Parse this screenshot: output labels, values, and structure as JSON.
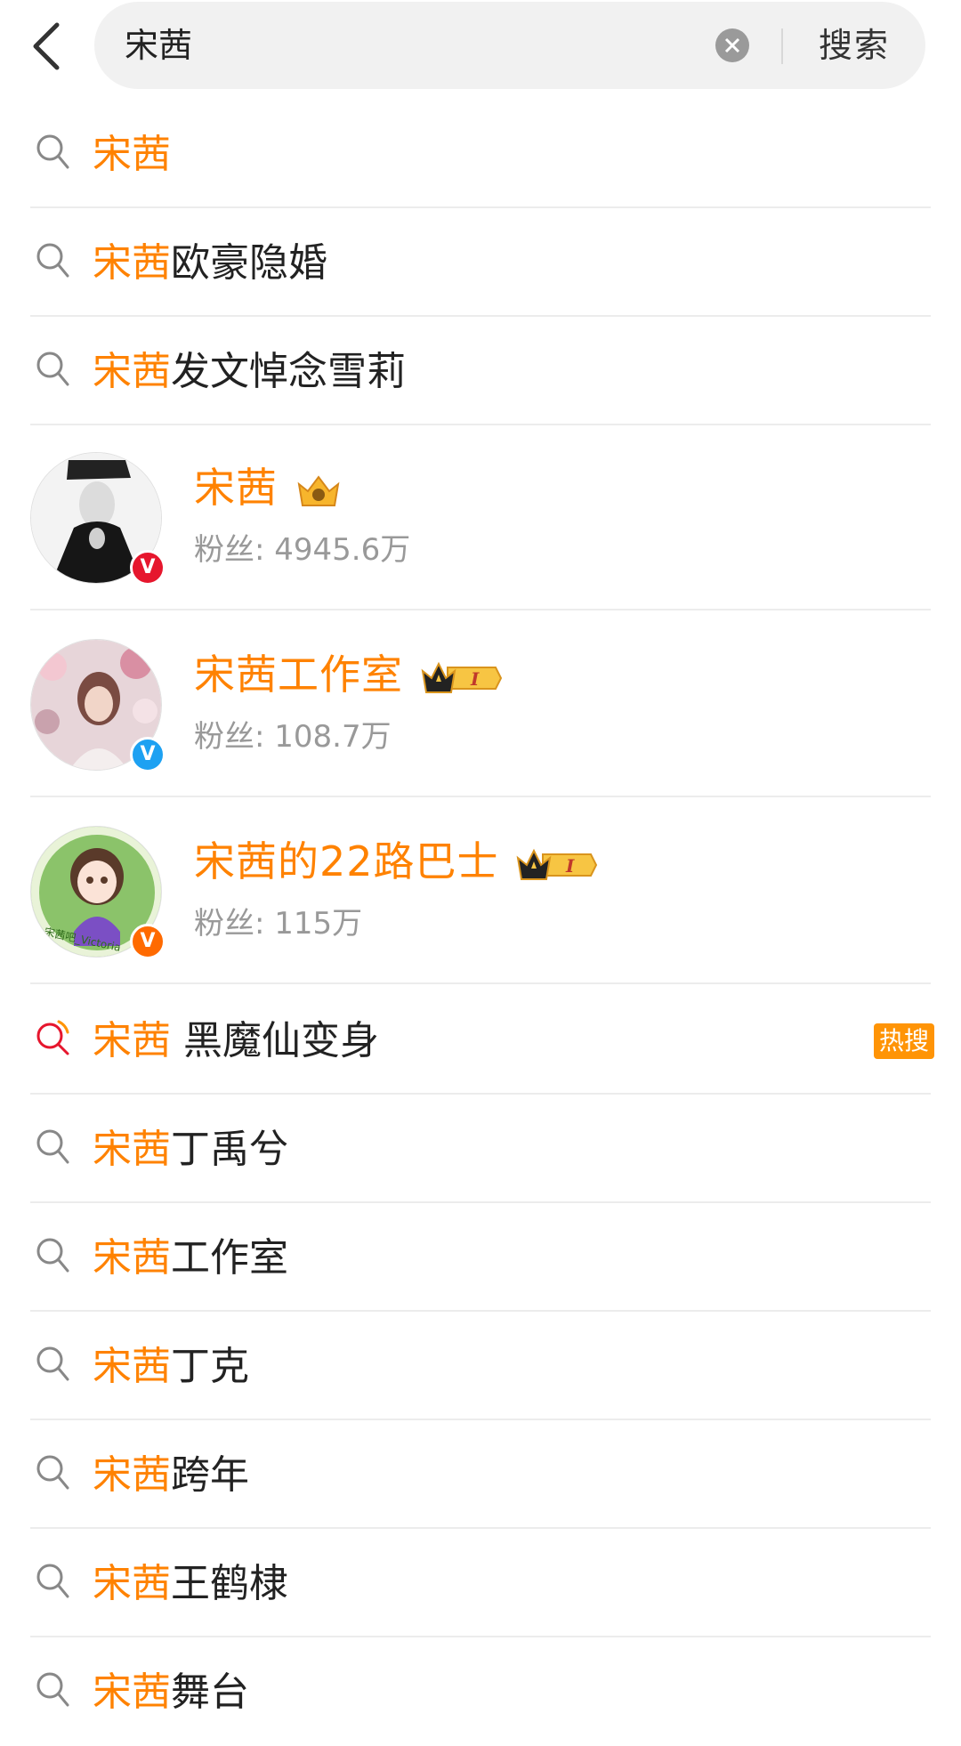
{
  "search": {
    "query": "宋茜",
    "button_label": "搜索"
  },
  "suggestions_top": [
    {
      "highlight": "宋茜",
      "rest": ""
    },
    {
      "highlight": "宋茜",
      "rest": "欧豪隐婚"
    },
    {
      "highlight": "宋茜",
      "rest": "发文悼念雪莉"
    }
  ],
  "users": [
    {
      "name": "宋茜",
      "fans": "粉丝: 4945.6万",
      "badge_color": "#e6162d",
      "badge": "V",
      "crown_level": ""
    },
    {
      "name": "宋茜工作室",
      "fans": "粉丝: 108.7万",
      "badge_color": "#1da1f2",
      "badge": "V",
      "crown_level": "I"
    },
    {
      "name": "宋茜的22路巴士",
      "fans": "粉丝: 115万",
      "badge_color": "#ff6a00",
      "badge": "V",
      "crown_level": "I",
      "avatar_text": "宋茜吧_Victoria"
    }
  ],
  "hot_search": {
    "highlight": "宋茜",
    "rest": " 黑魔仙变身",
    "tag": "热搜"
  },
  "suggestions_bottom": [
    {
      "highlight": "宋茜",
      "rest": "丁禹兮"
    },
    {
      "highlight": "宋茜",
      "rest": "工作室"
    },
    {
      "highlight": "宋茜",
      "rest": "丁克"
    },
    {
      "highlight": "宋茜",
      "rest": "跨年"
    },
    {
      "highlight": "宋茜",
      "rest": "王鹤棣"
    },
    {
      "highlight": "宋茜",
      "rest": "舞台"
    }
  ],
  "colors": {
    "accent": "#ff8200",
    "hot": "#ff9406"
  }
}
